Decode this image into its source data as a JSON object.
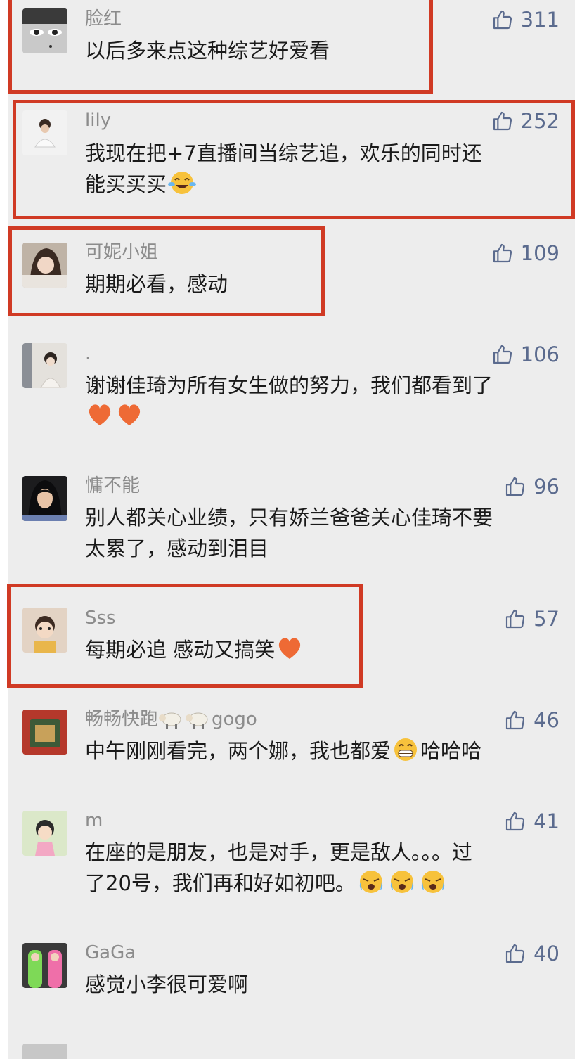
{
  "comments": [
    {
      "user": "脸红",
      "text": "以后多来点这种综艺好爱看",
      "likes": "311",
      "emoji": []
    },
    {
      "user": "lily",
      "text": "我现在把+7直播间当综艺追，欢乐的同时还\n能买买买",
      "likes": "252",
      "emoji": [
        "tears-of-joy"
      ]
    },
    {
      "user": "可妮小姐",
      "text": "期期必看，感动",
      "likes": "109",
      "emoji": []
    },
    {
      "user": ".",
      "text": "谢谢佳琦为所有女生做的努力，我们都看到了",
      "likes": "106",
      "emoji": [
        "heart",
        "heart"
      ]
    },
    {
      "user": "慵不能",
      "text": "别人都关心业绩，只有娇兰爸爸关心佳琦不要\n太累了，感动到泪目",
      "likes": "96",
      "emoji": []
    },
    {
      "user": "Sss",
      "text": "每期必追 感动又搞笑",
      "likes": "57",
      "emoji": [
        "heart"
      ]
    },
    {
      "user_prefix": "畅畅快跑",
      "user_suffix": "gogo",
      "user": "畅畅快跑🐑🐑gogo",
      "text": "中午刚刚看完，两个娜，我也都爱",
      "text_after": "哈哈哈",
      "likes": "46",
      "emoji": [
        "grin",
        "sheep",
        "sheep"
      ]
    },
    {
      "user": "m",
      "text": "在座的是朋友，也是对手，更是敌人。。。过\n了20号，我们再和好如初吧。",
      "likes": "41",
      "emoji": [
        "crying",
        "crying",
        "crying"
      ]
    },
    {
      "user": "GaGa",
      "text": "感觉小李很可爱啊",
      "likes": "40",
      "emoji": []
    }
  ],
  "colors": {
    "highlight": "#d03a24",
    "like": "#5b6b8e",
    "panel": "#ededed"
  },
  "icons": [
    "thumbs-up-icon"
  ]
}
